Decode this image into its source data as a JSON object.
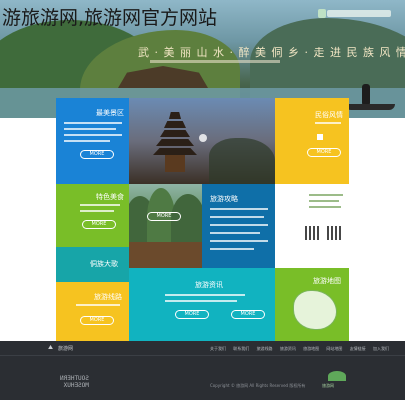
{
  "caption": "游旅游网,旅游网官方网站",
  "hero": {
    "slogan": "武 · 美 丽 山 水 · 醉 美 侗 乡 · 走 进 民 族 风 情",
    "colors": {
      "sky": "#8fb7c8",
      "mountain": "#3f6b3b",
      "river": "#6d9aa6"
    }
  },
  "tiles": {
    "top_left": {
      "title": "最美景区",
      "button": "MORE"
    },
    "right_top": {
      "title": "民俗风情",
      "button": "MORE"
    },
    "green_left": {
      "title": "特色美食",
      "button": "MORE"
    },
    "karst_button": "MORE",
    "center_blue": {
      "title": "旅游攻略"
    },
    "teal_left": {
      "title": "侗族大歌"
    },
    "yellow_left": {
      "title": "旅游线路",
      "button": "MORE"
    },
    "center_cyan": {
      "title": "旅游资讯",
      "button_left": "MORE",
      "button_right": "MORE"
    },
    "map_tile": {
      "title": "旅游地图"
    }
  },
  "footer": {
    "brand": "旅游网",
    "links": [
      "关于我们",
      "联系我们",
      "旅游线路",
      "旅游资讯",
      "旅游地图",
      "网站地图",
      "友情链接",
      "加入我们"
    ],
    "stamp_line1": "SOUTHERN",
    "stamp_line2": "MOSEHUX",
    "copyright": "Copyright © 旅游网 All Rights Reserved 版权所有"
  }
}
